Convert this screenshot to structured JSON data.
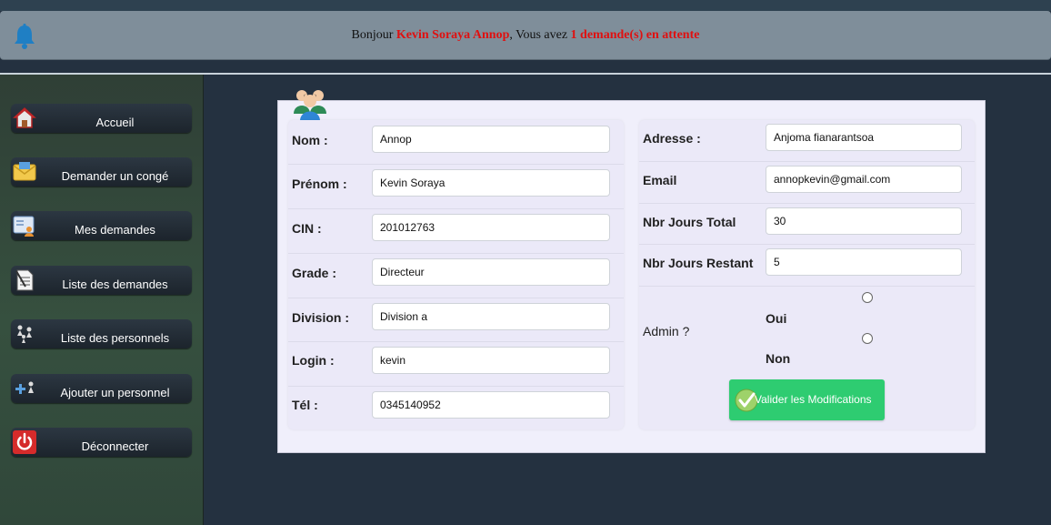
{
  "notification": {
    "greeting": "Bonjour ",
    "user_name": "Kevin Soraya Annop",
    "middle": ", Vous avez ",
    "pending": "1 demande(s) en attente"
  },
  "sidebar": {
    "items": [
      {
        "label": "Accueil",
        "icon": "home-icon"
      },
      {
        "label": "Demander un congé",
        "icon": "mail-icon"
      },
      {
        "label": "Mes demandes",
        "icon": "user-card-icon"
      },
      {
        "label": "Liste des demandes",
        "icon": "document-icon"
      },
      {
        "label": "Liste des personnels",
        "icon": "people-icon"
      },
      {
        "label": "Ajouter un personnel",
        "icon": "add-user-icon"
      },
      {
        "label": "Déconnecter",
        "icon": "power-icon"
      }
    ]
  },
  "form": {
    "left": [
      {
        "label": "Nom :",
        "value": "Annop"
      },
      {
        "label": "Prénom :",
        "value": "Kevin Soraya"
      },
      {
        "label": "CIN :",
        "value": "201012763"
      },
      {
        "label": "Grade :",
        "value": "Directeur"
      },
      {
        "label": "Division :",
        "value": "Division a"
      },
      {
        "label": "Login :",
        "value": "kevin"
      },
      {
        "label": "Tél :",
        "value": "0345140952"
      }
    ],
    "right": [
      {
        "label": "Adresse :",
        "value": "Anjoma fianarantsoa"
      },
      {
        "label": "Email",
        "value": "annopkevin@gmail.com"
      },
      {
        "label": "Nbr Jours Total",
        "value": "30"
      },
      {
        "label": "Nbr Jours Restant",
        "value": "5"
      }
    ],
    "admin": {
      "label": "Admin ?",
      "option_yes": "Oui",
      "option_no": "Non"
    },
    "submit_label": "Valider les Modifications"
  },
  "colors": {
    "accent_red": "#e01010",
    "submit_green": "#2ecc71",
    "background": "#243140"
  }
}
